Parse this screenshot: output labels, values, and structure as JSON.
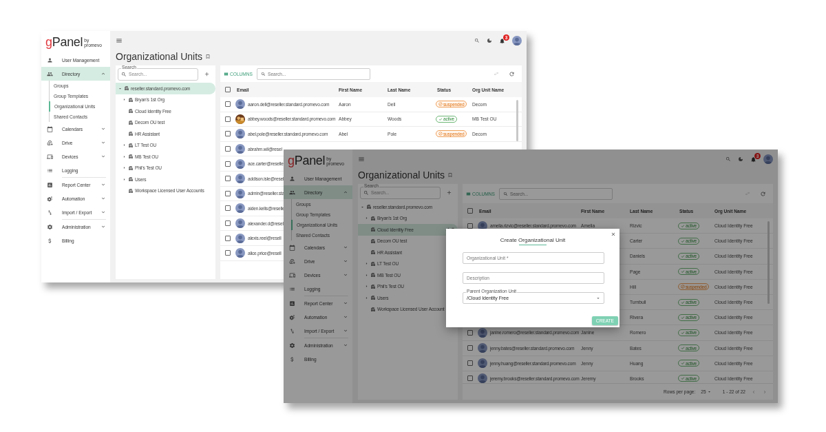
{
  "back_window": {
    "logo": {
      "mark": "g",
      "name": "Panel",
      "tag": "by promevo"
    },
    "sidebar": [
      {
        "label": "User Management",
        "selected": false
      },
      {
        "label": "Directory",
        "selected": true,
        "expanded": true,
        "children": [
          {
            "label": "Groups",
            "selected": false
          },
          {
            "label": "Group Templates",
            "selected": false
          },
          {
            "label": "Organizational Units",
            "selected": true
          },
          {
            "label": "Shared Contacts",
            "selected": false
          }
        ]
      },
      {
        "label": "Calendars",
        "selected": false,
        "expanded": false
      },
      {
        "label": "Drive",
        "selected": false,
        "expanded": false
      },
      {
        "label": "Devices",
        "selected": false,
        "expanded": false
      },
      {
        "label": "Logging",
        "selected": false
      },
      {
        "label": "Report Center",
        "selected": false,
        "expanded": false
      },
      {
        "label": "Automation",
        "selected": false,
        "expanded": false
      },
      {
        "label": "Import / Export",
        "selected": false,
        "expanded": false
      },
      {
        "label": "Administration",
        "selected": false,
        "expanded": false
      },
      {
        "label": "Billing",
        "selected": false
      }
    ],
    "notifications": "3",
    "title": "Organizational Units",
    "tree_search": {
      "label": "Search",
      "placeholder": "Search..."
    },
    "tree": [
      {
        "label": "reseller.standard.promevo.com",
        "selected": true,
        "expanded": true,
        "children": [
          {
            "label": "Bryan's 1st Org",
            "selected": false,
            "expanded": false
          },
          {
            "label": "Cloud Identity Free",
            "selected": false
          },
          {
            "label": "Decom OU test",
            "selected": false
          },
          {
            "label": "HR Assistant",
            "selected": false
          },
          {
            "label": "LT Test OU",
            "selected": false,
            "expanded": false
          },
          {
            "label": "MB Test OU",
            "selected": false,
            "expanded": false
          },
          {
            "label": "Phil's Test OU",
            "selected": false,
            "expanded": false
          },
          {
            "label": "Users",
            "selected": false,
            "expanded": false
          },
          {
            "label": "Workspace Licensed User Accounts",
            "selected": false
          }
        ]
      }
    ],
    "table": {
      "columns_button": "COLUMNS",
      "search_placeholder": "Search...",
      "all_checked": false,
      "columns": [
        "Email",
        "First Name",
        "Last Name",
        "Status",
        "Org Unit Name"
      ],
      "rows": [
        {
          "checked": false,
          "photo": false,
          "email": "aaron.dell@reseller.standard.promevo.com",
          "first_name": "Aaron",
          "last_name": "Dell",
          "status": {
            "kind": "suspended",
            "label": "suspended"
          },
          "org_unit": "Decom"
        },
        {
          "checked": false,
          "photo": true,
          "email": "abbey.woods@reseller.standard.promevo.com",
          "first_name": "Abbey",
          "last_name": "Woods",
          "status": {
            "kind": "active",
            "label": "active"
          },
          "org_unit": "MB Test OU"
        },
        {
          "checked": false,
          "photo": false,
          "email": "abel.pole@reseller.standard.promevo.com",
          "first_name": "Abel",
          "last_name": "Pole",
          "status": {
            "kind": "suspended",
            "label": "suspended"
          },
          "org_unit": "Decom"
        },
        {
          "checked": false,
          "photo": false,
          "email": "abrahm.wil@resel"
        },
        {
          "checked": false,
          "photo": false,
          "email": "ace.carter@reselle"
        },
        {
          "checked": false,
          "photo": false,
          "email": "addison.isle@resel"
        },
        {
          "checked": false,
          "photo": false,
          "email": "admin@reseller.sta"
        },
        {
          "checked": false,
          "photo": false,
          "email": "aiden.kells@reselle"
        },
        {
          "checked": false,
          "photo": false,
          "email": "alexander.d@resel"
        },
        {
          "checked": false,
          "photo": false,
          "email": "alexis.reel@resell"
        },
        {
          "checked": false,
          "photo": false,
          "email": "alice.price@resell"
        }
      ]
    }
  },
  "front_window": {
    "logo": {
      "mark": "g",
      "name": "Panel",
      "tag": "by promevo"
    },
    "sidebar": [
      {
        "label": "User Management",
        "selected": false
      },
      {
        "label": "Directory",
        "selected": true,
        "expanded": true,
        "children": [
          {
            "label": "Groups",
            "selected": false
          },
          {
            "label": "Group Templates",
            "selected": false
          },
          {
            "label": "Organizational Units",
            "selected": true
          },
          {
            "label": "Shared Contacts",
            "selected": false
          }
        ]
      },
      {
        "label": "Calendars",
        "selected": false,
        "expanded": false
      },
      {
        "label": "Drive",
        "selected": false,
        "expanded": false
      },
      {
        "label": "Devices",
        "selected": false,
        "expanded": false
      },
      {
        "label": "Logging",
        "selected": false
      },
      {
        "label": "Report Center",
        "selected": false,
        "expanded": false
      },
      {
        "label": "Automation",
        "selected": false,
        "expanded": false
      },
      {
        "label": "Import / Export",
        "selected": false,
        "expanded": false
      },
      {
        "label": "Administration",
        "selected": false,
        "expanded": false
      },
      {
        "label": "Billing",
        "selected": false
      }
    ],
    "notifications": "3",
    "title": "Organizational Units",
    "tree_search": {
      "label": "Search",
      "placeholder": "Search..."
    },
    "tree": [
      {
        "label": "reseller.standard.promevo.com",
        "selected": false,
        "expanded": true,
        "children": [
          {
            "label": "Bryan's 1st Org",
            "selected": false,
            "expanded": false
          },
          {
            "label": "Cloud Identity Free",
            "selected": true
          },
          {
            "label": "Decom OU test",
            "selected": false
          },
          {
            "label": "HR Assistant",
            "selected": false
          },
          {
            "label": "LT Test OU",
            "selected": false,
            "expanded": false
          },
          {
            "label": "MB Test OU",
            "selected": false,
            "expanded": false
          },
          {
            "label": "Phil's Test OU",
            "selected": false,
            "expanded": false
          },
          {
            "label": "Users",
            "selected": false,
            "expanded": false
          },
          {
            "label": "Workspace Licensed User Account",
            "selected": false
          }
        ]
      }
    ],
    "table": {
      "columns_button": "COLUMNS",
      "search_placeholder": "Search...",
      "all_checked": false,
      "columns": [
        "Email",
        "First Name",
        "Last Name",
        "Status",
        "Org Unit Name"
      ],
      "rows": [
        {
          "checked": false,
          "photo": false,
          "email": "amelia.rizvic@reseller.standard.promevo.com",
          "first_name": "Amelia",
          "last_name": "Rizvic",
          "status": {
            "kind": "active",
            "label": "active"
          },
          "org_unit": "Cloud Identity Free"
        },
        {
          "last_name": "Carter",
          "status": {
            "kind": "active",
            "label": "active"
          },
          "org_unit": "Cloud Identity Free"
        },
        {
          "last_name": "Daniels",
          "status": {
            "kind": "active",
            "label": "active"
          },
          "org_unit": "Cloud Identity Free"
        },
        {
          "last_name": "Page",
          "status": {
            "kind": "active",
            "label": "active"
          },
          "org_unit": "Cloud Identity Free"
        },
        {
          "last_name": "Hill",
          "status": {
            "kind": "suspended",
            "label": "suspended"
          },
          "org_unit": "Cloud Identity Free"
        },
        {
          "last_name": "Turnbull",
          "status": {
            "kind": "active",
            "label": "active"
          },
          "org_unit": "Cloud Identity Free"
        },
        {
          "last_name": "Rivera",
          "status": {
            "kind": "active",
            "label": "active"
          },
          "org_unit": "Cloud Identity Free"
        },
        {
          "checked": false,
          "photo": false,
          "email": "janine.romero@reseller.standard.promevo.com",
          "first_name": "Janine",
          "last_name": "Romero",
          "status": {
            "kind": "active",
            "label": "active"
          },
          "org_unit": "Cloud Identity Free"
        },
        {
          "checked": false,
          "photo": false,
          "email": "jenny.bates@reseller.standard.promevo.com",
          "first_name": "Jenny",
          "last_name": "Bates",
          "status": {
            "kind": "active",
            "label": "active"
          },
          "org_unit": "Cloud Identity Free"
        },
        {
          "checked": false,
          "photo": false,
          "email": "jenny.huang@reseller.standard.promevo.com",
          "first_name": "Jenny",
          "last_name": "Huang",
          "status": {
            "kind": "active",
            "label": "active"
          },
          "org_unit": "Cloud Identity Free"
        },
        {
          "checked": false,
          "photo": false,
          "email": "jeremy.brooks@reseller.standard.promevo.com",
          "first_name": "Jeremy",
          "last_name": "Brooks",
          "status": {
            "kind": "active",
            "label": "active"
          },
          "org_unit": "Cloud Identity Free"
        }
      ],
      "footer": {
        "rows_per_page_label": "Rows per page:",
        "rows_per_page": "25",
        "range": "1 - 22 of 22"
      }
    }
  },
  "dialog": {
    "title": "Create Organizational Unit",
    "fields": [
      {
        "kind": "text",
        "placeholder": "Organizational Unit *"
      },
      {
        "kind": "text",
        "placeholder": "Description"
      },
      {
        "kind": "select",
        "label": "Parent Organization Unit",
        "value": "/Cloud Identity Free"
      }
    ],
    "button": "CREATE"
  }
}
